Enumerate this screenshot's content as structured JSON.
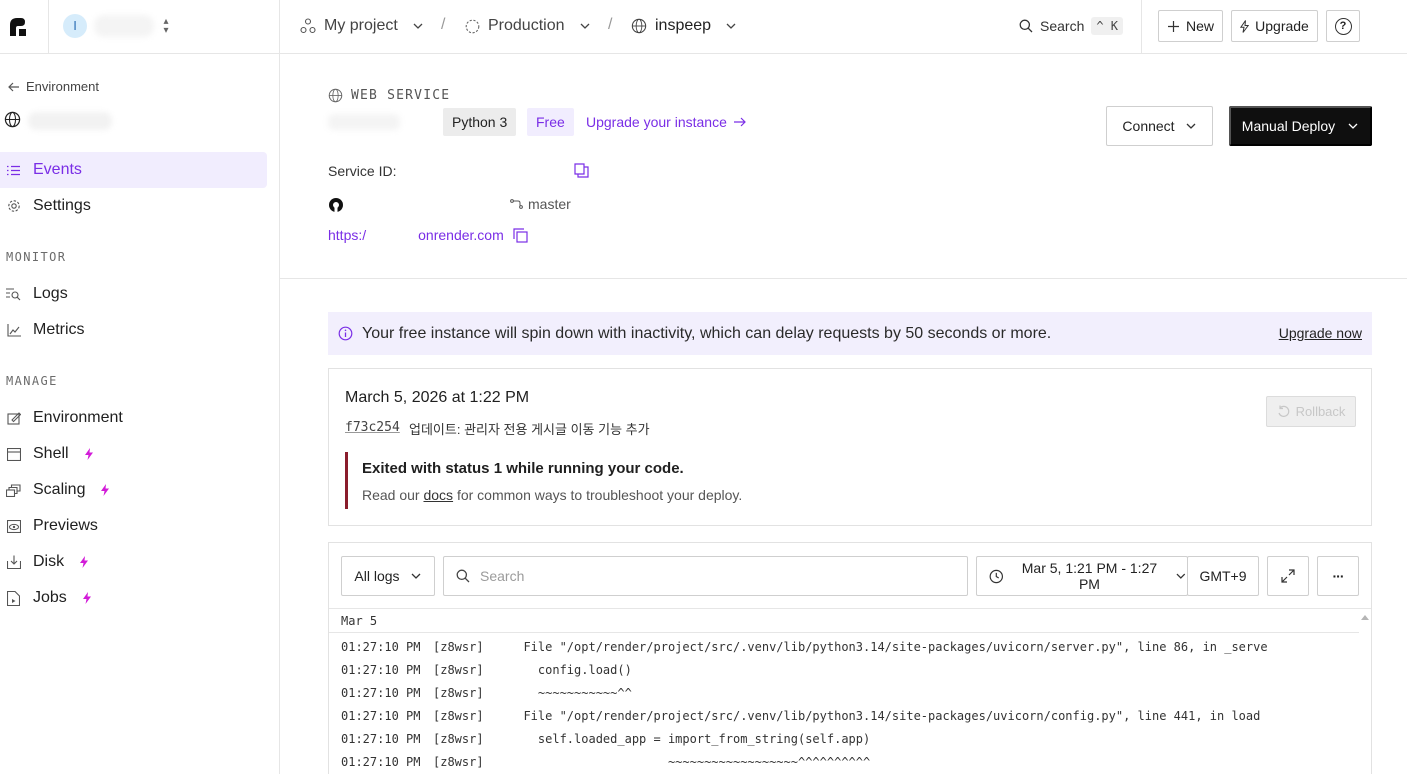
{
  "workspace": {
    "avatar_initial": "I"
  },
  "breadcrumbs": {
    "project": "My project",
    "environment": "Production",
    "service": "inspeep",
    "separator": "/"
  },
  "topbar": {
    "search_label": "Search",
    "search_shortcut": "^ K",
    "new_label": "New",
    "upgrade_label": "Upgrade",
    "help_label": "?"
  },
  "sidebar": {
    "back_label": "Environment",
    "nav_primary": [
      {
        "label": "Events",
        "icon": "list-icon",
        "active": true
      },
      {
        "label": "Settings",
        "icon": "gear-icon",
        "active": false
      }
    ],
    "monitor_label": "MONITOR",
    "nav_monitor": [
      {
        "label": "Logs",
        "icon": "log-search-icon"
      },
      {
        "label": "Metrics",
        "icon": "chart-icon"
      }
    ],
    "manage_label": "MANAGE",
    "nav_manage": [
      {
        "label": "Environment",
        "icon": "env-icon",
        "paid": false
      },
      {
        "label": "Shell",
        "icon": "terminal-icon",
        "paid": true
      },
      {
        "label": "Scaling",
        "icon": "scaling-icon",
        "paid": true
      },
      {
        "label": "Previews",
        "icon": "eye-icon",
        "paid": false
      },
      {
        "label": "Disk",
        "icon": "disk-icon",
        "paid": true
      },
      {
        "label": "Jobs",
        "icon": "jobs-icon",
        "paid": true
      }
    ]
  },
  "service": {
    "type_label": "WEB SERVICE",
    "runtime": "Python 3",
    "plan": "Free",
    "upgrade_link": "Upgrade your instance",
    "connect_label": "Connect",
    "deploy_label": "Manual Deploy",
    "service_id_label": "Service ID:",
    "branch": "master",
    "url_prefix": "https:/",
    "url_suffix": "onrender.com"
  },
  "banner": {
    "text": "Your free instance will spin down with inactivity, which can delay requests by 50 seconds or more.",
    "link": "Upgrade now"
  },
  "event": {
    "date": "March 5, 2026 at 1:22 PM",
    "commit_hash": "f73c254",
    "commit_message": "업데이트: 관리자 전용 게시글 이동 기능 추가",
    "rollback_label": "Rollback",
    "error_title": "Exited with status 1 while running your code.",
    "error_prefix": "Read our ",
    "error_link": "docs",
    "error_suffix": " for common ways to troubleshoot your deploy."
  },
  "logs": {
    "filter_label": "All logs",
    "search_placeholder": "Search",
    "time_range": "Mar 5, 1:21 PM - 1:27 PM",
    "timezone": "GMT+9",
    "more_label": "···",
    "day_label": "Mar 5",
    "rows": [
      {
        "time": "01:27:10 PM",
        "instance": "[z8wsr]",
        "text": "  File \"/opt/render/project/src/.venv/lib/python3.14/site-packages/uvicorn/server.py\", line 86, in _serve"
      },
      {
        "time": "01:27:10 PM",
        "instance": "[z8wsr]",
        "text": "    config.load()"
      },
      {
        "time": "01:27:10 PM",
        "instance": "[z8wsr]",
        "text": "    ~~~~~~~~~~~^^"
      },
      {
        "time": "01:27:10 PM",
        "instance": "[z8wsr]",
        "text": "  File \"/opt/render/project/src/.venv/lib/python3.14/site-packages/uvicorn/config.py\", line 441, in load"
      },
      {
        "time": "01:27:10 PM",
        "instance": "[z8wsr]",
        "text": "    self.loaded_app = import_from_string(self.app)"
      },
      {
        "time": "01:27:10 PM",
        "instance": "[z8wsr]",
        "text": "                      ~~~~~~~~~~~~~~~~~~^^^^^^^^^^"
      }
    ]
  },
  "colors": {
    "accent": "#7a2ee6",
    "accent_bg": "#f1edfe",
    "error_border": "#8a1d2c",
    "paid_bolt": "#d21bd8"
  }
}
